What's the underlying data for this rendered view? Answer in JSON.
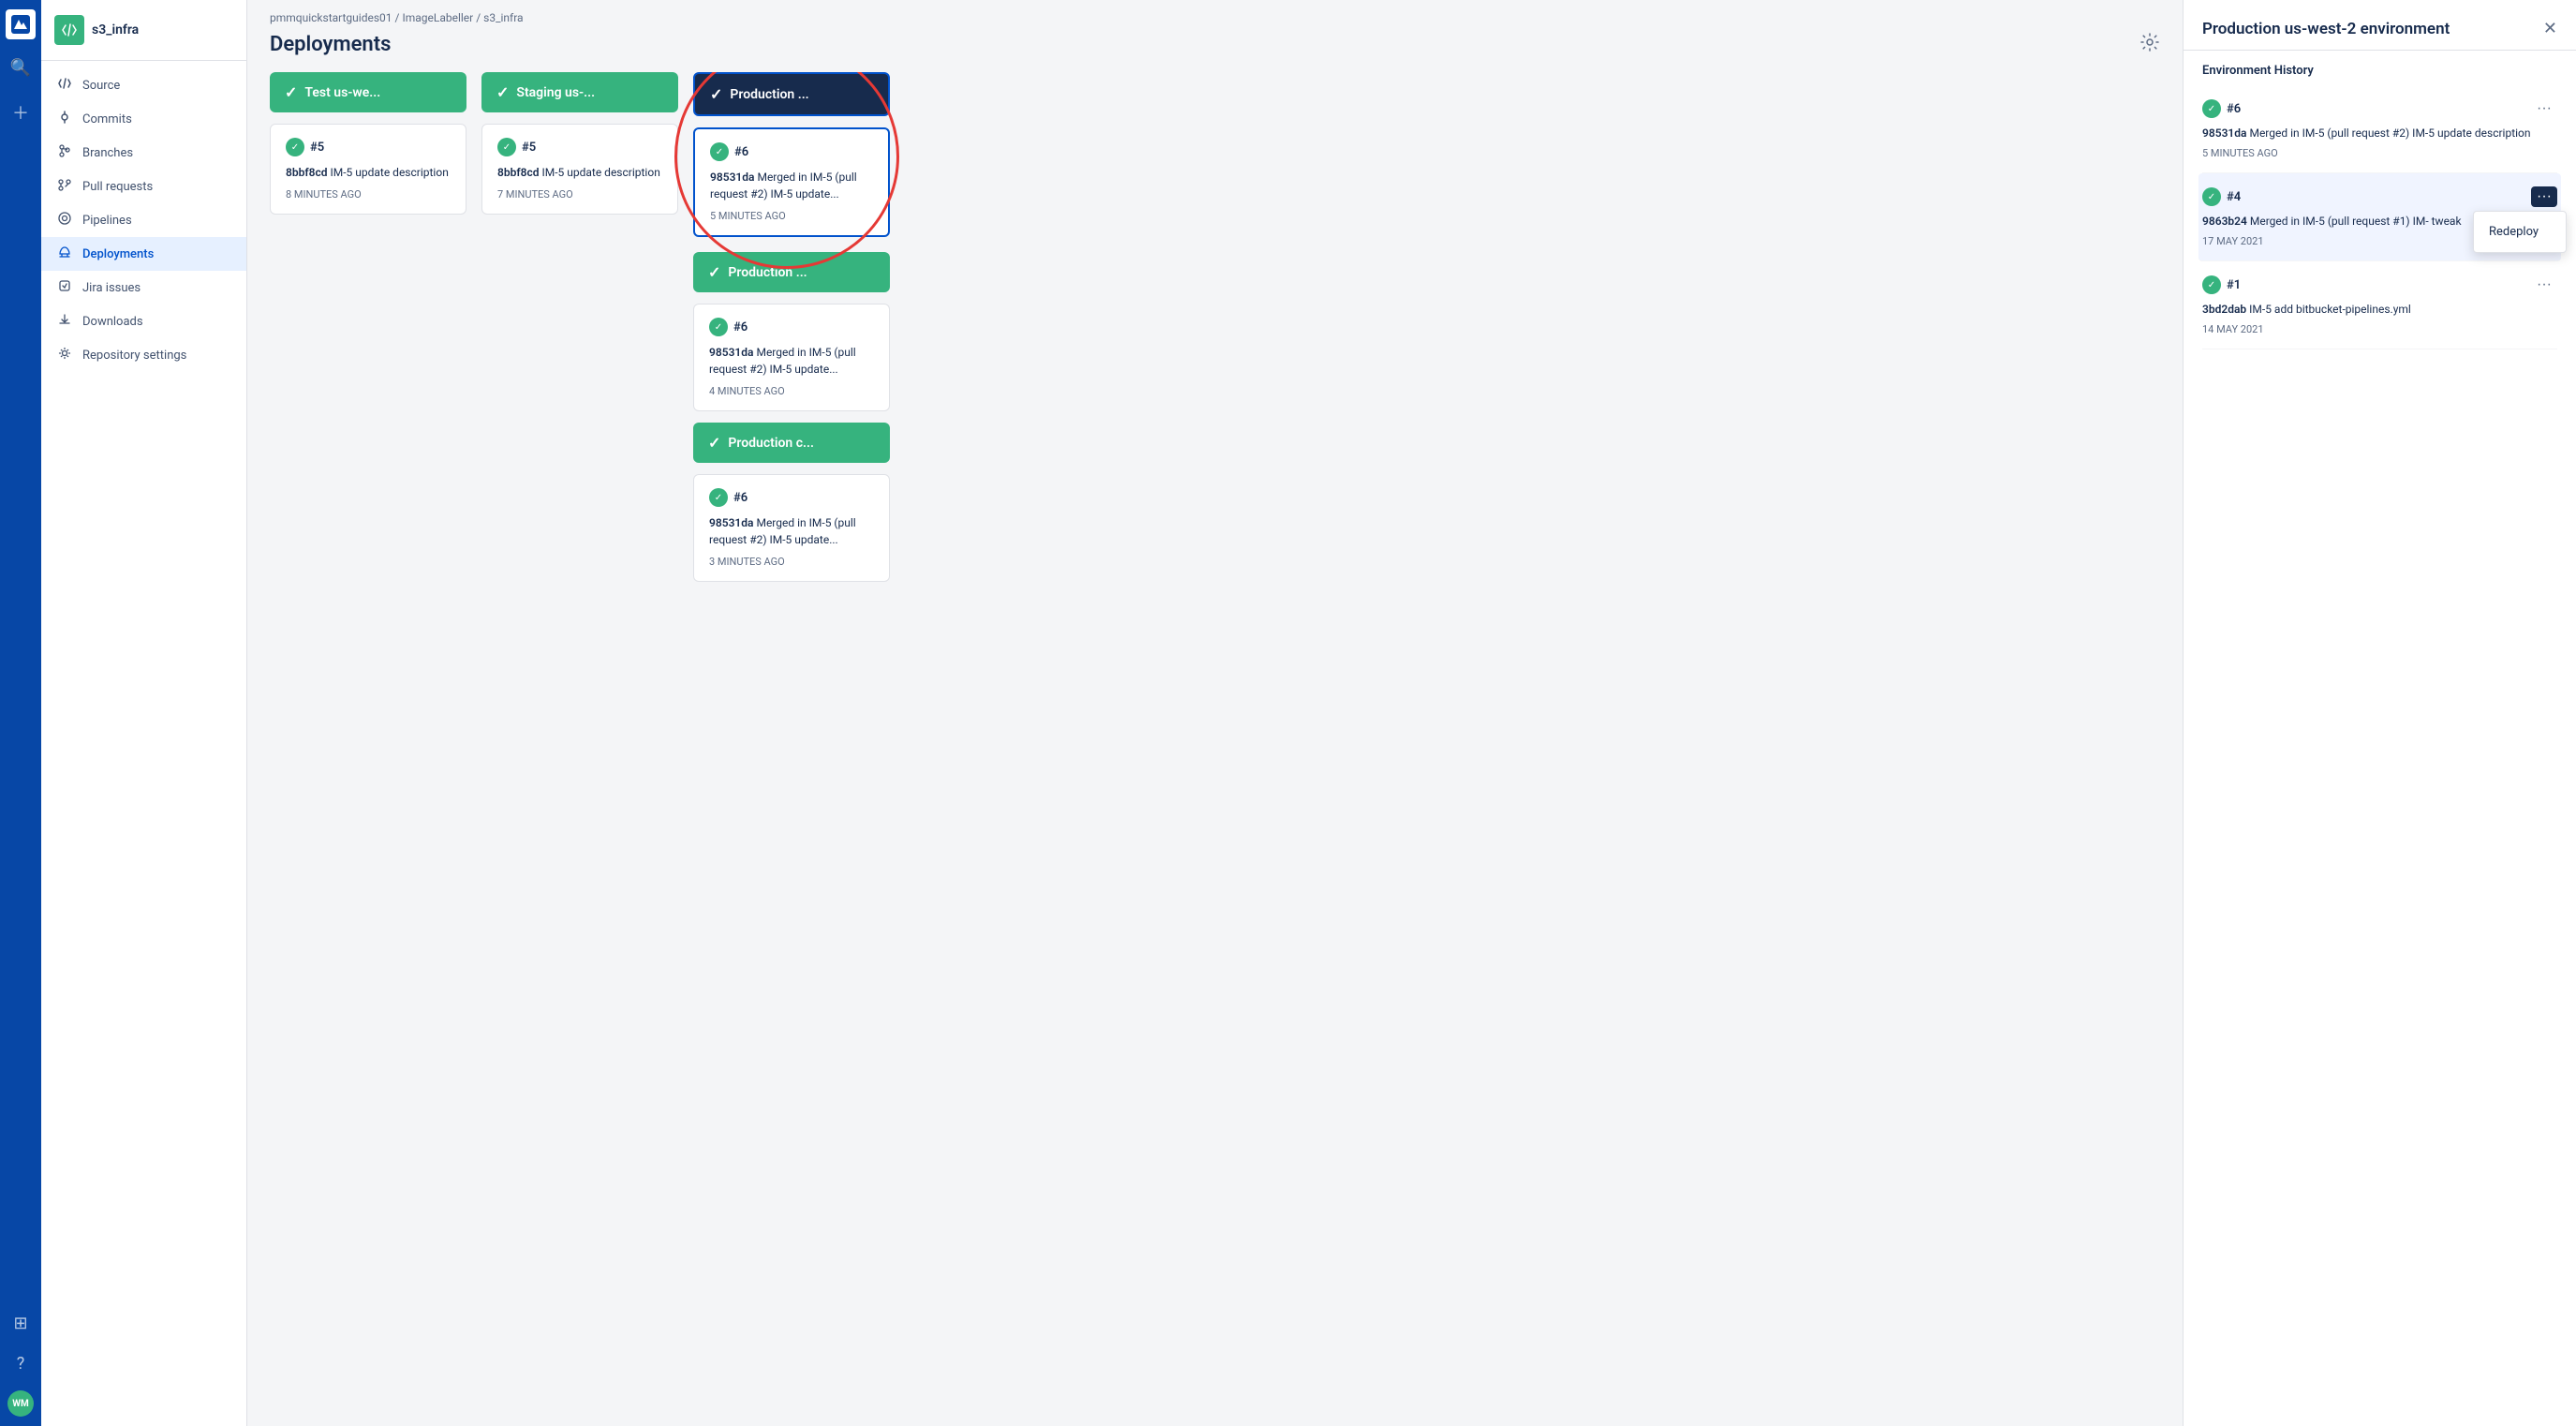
{
  "app": {
    "logo": "⊞",
    "repo_icon": "</>",
    "repo_name": "s3_infra"
  },
  "breadcrumb": {
    "org": "pmmquickstartguides01",
    "repo": "ImageLabeller",
    "page": "s3_infra"
  },
  "page": {
    "title": "Deployments",
    "settings_tooltip": "Settings"
  },
  "sidebar": {
    "items": [
      {
        "id": "source",
        "label": "Source",
        "icon": "<>"
      },
      {
        "id": "commits",
        "label": "Commits",
        "icon": "◌"
      },
      {
        "id": "branches",
        "label": "Branches",
        "icon": "⑂"
      },
      {
        "id": "pull-requests",
        "label": "Pull requests",
        "icon": "⇄"
      },
      {
        "id": "pipelines",
        "label": "Pipelines",
        "icon": "○"
      },
      {
        "id": "deployments",
        "label": "Deployments",
        "icon": "↑",
        "active": true
      },
      {
        "id": "jira-issues",
        "label": "Jira issues",
        "icon": "◆"
      },
      {
        "id": "downloads",
        "label": "Downloads",
        "icon": "☰"
      },
      {
        "id": "repository-settings",
        "label": "Repository settings",
        "icon": "⚙"
      }
    ]
  },
  "environments": [
    {
      "id": "test",
      "name": "Test us-we...",
      "status": "success",
      "selected": false,
      "deployment": {
        "number": "#5",
        "commit_hash": "8bbf8cd",
        "message": "IM-5 update description",
        "time": "8 MINUTES AGO"
      }
    },
    {
      "id": "staging",
      "name": "Staging us-...",
      "status": "success",
      "selected": false,
      "deployment": {
        "number": "#5",
        "commit_hash": "8bbf8cd",
        "message": "IM-5 update description",
        "time": "7 MINUTES AGO"
      }
    },
    {
      "id": "production-1",
      "name": "Production ...",
      "status": "success",
      "selected": true,
      "deployment": {
        "number": "#6",
        "commit_hash": "98531da",
        "message": "Merged in IM-5 (pull request #2) IM-5 update...",
        "time": "5 MINUTES AGO"
      }
    }
  ],
  "production_column": {
    "environments": [
      {
        "id": "production-2",
        "name": "Production ...",
        "status": "success",
        "deployment": {
          "number": "#6",
          "commit_hash": "98531da",
          "message": "Merged in IM-5 (pull request #2) IM-5 update...",
          "time": "4 MINUTES AGO"
        }
      },
      {
        "id": "production-c",
        "name": "Production c...",
        "status": "success",
        "deployment": {
          "number": "#6",
          "commit_hash": "98531da",
          "message": "Merged in IM-5 (pull request #2) IM-5 update...",
          "time": "3 MINUTES AGO"
        }
      }
    ]
  },
  "right_panel": {
    "title": "Production us-west-2 environment",
    "section_label": "Environment History",
    "history": [
      {
        "id": "h6",
        "number": "#6",
        "commit_hash": "98531da",
        "message": "Merged in IM-5 (pull request #2) IM-5 update description",
        "time": "5 MINUTES AGO",
        "highlighted": false
      },
      {
        "id": "h4",
        "number": "#4",
        "commit_hash": "9863b24",
        "message": "Merged in IM-5 (pull request #1) IM- tweak",
        "time": "17 MAY 2021",
        "highlighted": true,
        "show_popover": true
      },
      {
        "id": "h1",
        "number": "#1",
        "commit_hash": "3bd2dab",
        "message": "IM-5 add bitbucket-pipelines.yml",
        "time": "14 MAY 2021",
        "highlighted": false
      }
    ],
    "redeploy_label": "Redeploy"
  }
}
